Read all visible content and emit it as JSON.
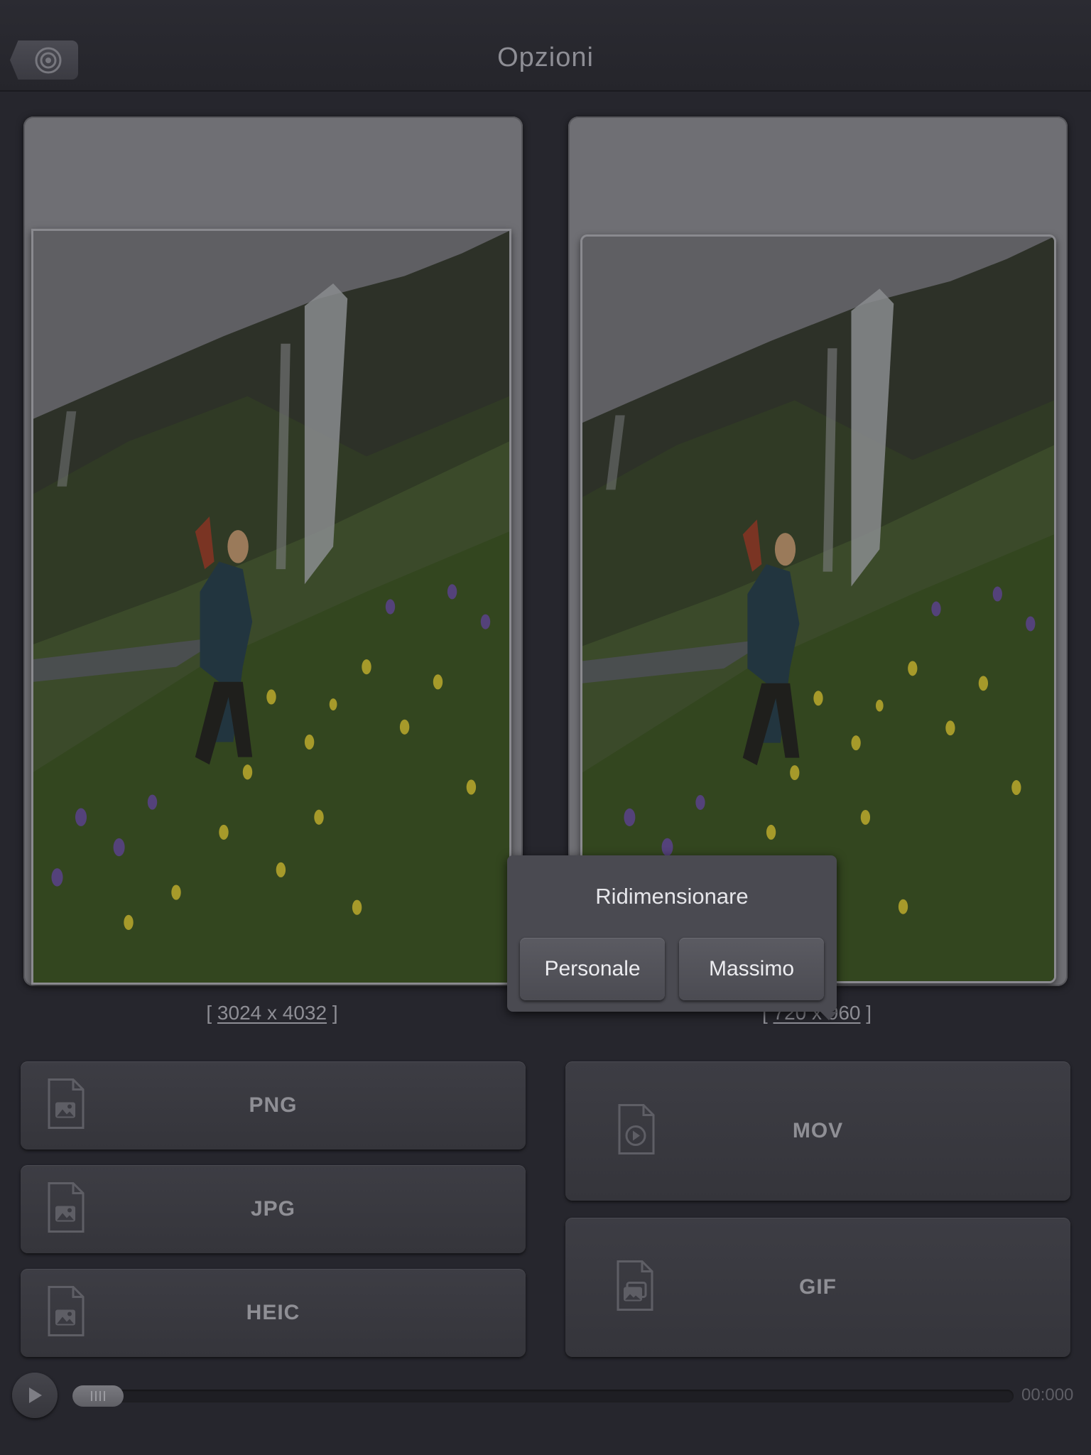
{
  "navbar": {
    "title": "Opzioni",
    "back_icon": "target-icon"
  },
  "preview": {
    "original_size": "3024 x 4032",
    "output_size": "720 x 960"
  },
  "formats": {
    "left": [
      {
        "label": "PNG",
        "icon": "image-file-icon"
      },
      {
        "label": "JPG",
        "icon": "image-file-icon"
      },
      {
        "label": "HEIC",
        "icon": "image-file-icon"
      }
    ],
    "right": [
      {
        "label": "MOV",
        "icon": "video-file-icon"
      },
      {
        "label": "GIF",
        "icon": "gif-file-icon"
      }
    ]
  },
  "player": {
    "time": "00:000",
    "play_icon": "play-icon"
  },
  "popover": {
    "title": "Ridimensionare",
    "option_custom": "Personale",
    "option_max": "Massimo"
  },
  "colors": {
    "background": "#26262d",
    "panel": "#6f6f74",
    "popover": "#4a4a51"
  }
}
